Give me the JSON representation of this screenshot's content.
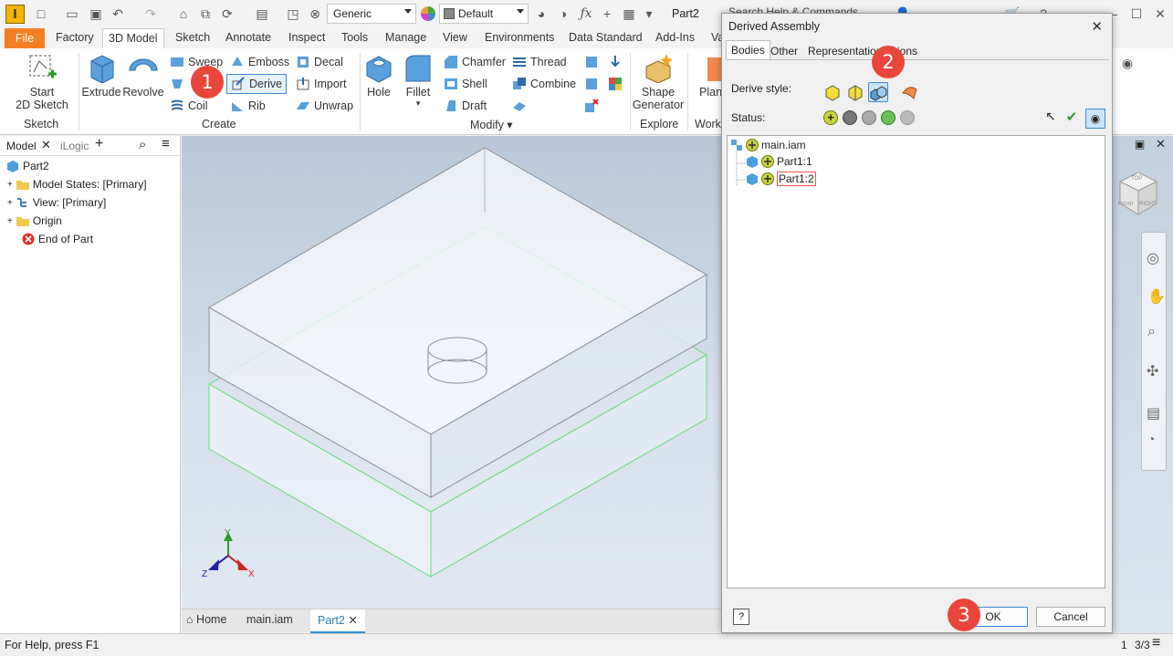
{
  "quick_access": {
    "app_logo_letter": "I",
    "appearance_combo": "Generic",
    "material_combo": "Default",
    "document_name": "Part2"
  },
  "ribbon_tabs": [
    {
      "label": "File"
    },
    {
      "label": "Factory"
    },
    {
      "label": "3D Model"
    },
    {
      "label": "Sketch"
    },
    {
      "label": "Annotate"
    },
    {
      "label": "Inspect"
    },
    {
      "label": "Tools"
    },
    {
      "label": "Manage"
    },
    {
      "label": "View"
    },
    {
      "label": "Environments"
    },
    {
      "label": "Data Standard"
    },
    {
      "label": "Add-Ins"
    },
    {
      "label": "Va"
    }
  ],
  "ribbon": {
    "sketch": {
      "start_line1": "Start",
      "start_line2": "2D Sketch",
      "group": "Sketch"
    },
    "create": {
      "extrude": "Extrude",
      "revolve": "Revolve",
      "sweep": "Sweep",
      "coil": "Coil",
      "emboss": "Emboss",
      "derive": "Derive",
      "rib": "Rib",
      "decal": "Decal",
      "import": "Import",
      "unwrap": "Unwrap",
      "group": "Create"
    },
    "modify": {
      "hole": "Hole",
      "fillet": "Fillet",
      "chamfer": "Chamfer",
      "shell": "Shell",
      "draft": "Draft",
      "thread": "Thread",
      "combine": "Combine",
      "group": "Modify"
    },
    "explore": {
      "shape_line1": "Shape",
      "shape_line2": "Generator",
      "group": "Explore"
    },
    "work": {
      "plane": "Plane",
      "group": "Work"
    }
  },
  "browser": {
    "tab_model": "Model",
    "tab_ilogic": "iLogic",
    "items": [
      {
        "label": "Part2"
      },
      {
        "label": "Model States: [Primary]"
      },
      {
        "label": "View: [Primary]"
      },
      {
        "label": "Origin"
      },
      {
        "label": "End of Part"
      }
    ]
  },
  "viewport": {
    "axis_y": "Y",
    "axis_x": "X",
    "axis_z": "Z",
    "viewcube_top": "TOP",
    "viewcube_front": "FRONT",
    "viewcube_right": "RIGHT"
  },
  "document_tabs": [
    {
      "label": "Home"
    },
    {
      "label": "main.iam"
    },
    {
      "label": "Part2"
    }
  ],
  "status_bar": {
    "help_text": "For Help, press F1",
    "count_a": "1",
    "count_b": "3/3"
  },
  "dialog": {
    "title": "Derived Assembly",
    "tabs": [
      {
        "label": "Bodies"
      },
      {
        "label": "Other"
      },
      {
        "label": "Representation"
      },
      {
        "label": "ions"
      }
    ],
    "derive_style_label": "Derive style:",
    "status_label": "Status:",
    "tree": [
      {
        "label": "main.iam"
      },
      {
        "label": "Part1:1"
      },
      {
        "label": "Part1:2"
      }
    ],
    "help_glyph": "?",
    "ok_label": "OK",
    "cancel_label": "Cancel"
  },
  "callouts": [
    {
      "number": "1"
    },
    {
      "number": "2"
    },
    {
      "number": "3"
    }
  ],
  "background_hint": "Search Help & Commands"
}
